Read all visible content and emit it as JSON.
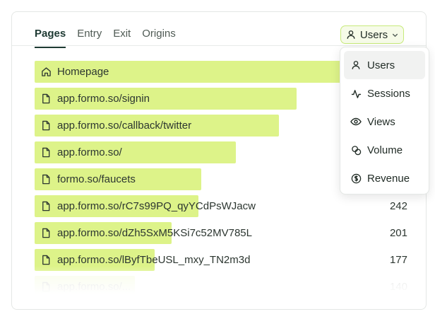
{
  "tabs": [
    {
      "label": "Pages",
      "active": true
    },
    {
      "label": "Entry",
      "active": false
    },
    {
      "label": "Exit",
      "active": false
    },
    {
      "label": "Origins",
      "active": false
    }
  ],
  "metric_selector": {
    "label": "Users",
    "icon": "user-icon",
    "accent": "#c7ea7a"
  },
  "bar_color": "#ddf389",
  "rows": [
    {
      "label": "Homepage",
      "value": "",
      "icon": "home-icon",
      "fraction": 0.93
    },
    {
      "label": "app.formo.so/signin",
      "value": "",
      "icon": "file-icon",
      "fraction": 0.687
    },
    {
      "label": "app.formo.so/callback/twitter",
      "value": "",
      "icon": "file-icon",
      "fraction": 0.641
    },
    {
      "label": "app.formo.so/",
      "value": "",
      "icon": "file-icon",
      "fraction": 0.528
    },
    {
      "label": "formo.so/faucets",
      "value": "",
      "icon": "file-icon",
      "fraction": 0.437
    },
    {
      "label": "app.formo.so/rC7s99PQ_qyYCdPsWJacw",
      "value": "242",
      "icon": "file-icon",
      "fraction": 0.43
    },
    {
      "label": "app.formo.so/dZh5SxM5KSi7c52MV785L",
      "value": "201",
      "icon": "file-icon",
      "fraction": 0.359
    },
    {
      "label": "app.formo.so/lByfTbeUSL_mxy_TN2m3d",
      "value": "177",
      "icon": "file-icon",
      "fraction": 0.315
    },
    {
      "label": "app.formo.so/...",
      "value": "140",
      "icon": "file-icon",
      "fraction": 0.263
    }
  ],
  "dropdown": {
    "items": [
      {
        "label": "Users",
        "icon": "user-icon",
        "selected": true
      },
      {
        "label": "Sessions",
        "icon": "activity-icon",
        "selected": false
      },
      {
        "label": "Views",
        "icon": "eye-icon",
        "selected": false
      },
      {
        "label": "Volume",
        "icon": "coins-icon",
        "selected": false
      },
      {
        "label": "Revenue",
        "icon": "dollar-circle-icon",
        "selected": false
      }
    ]
  }
}
